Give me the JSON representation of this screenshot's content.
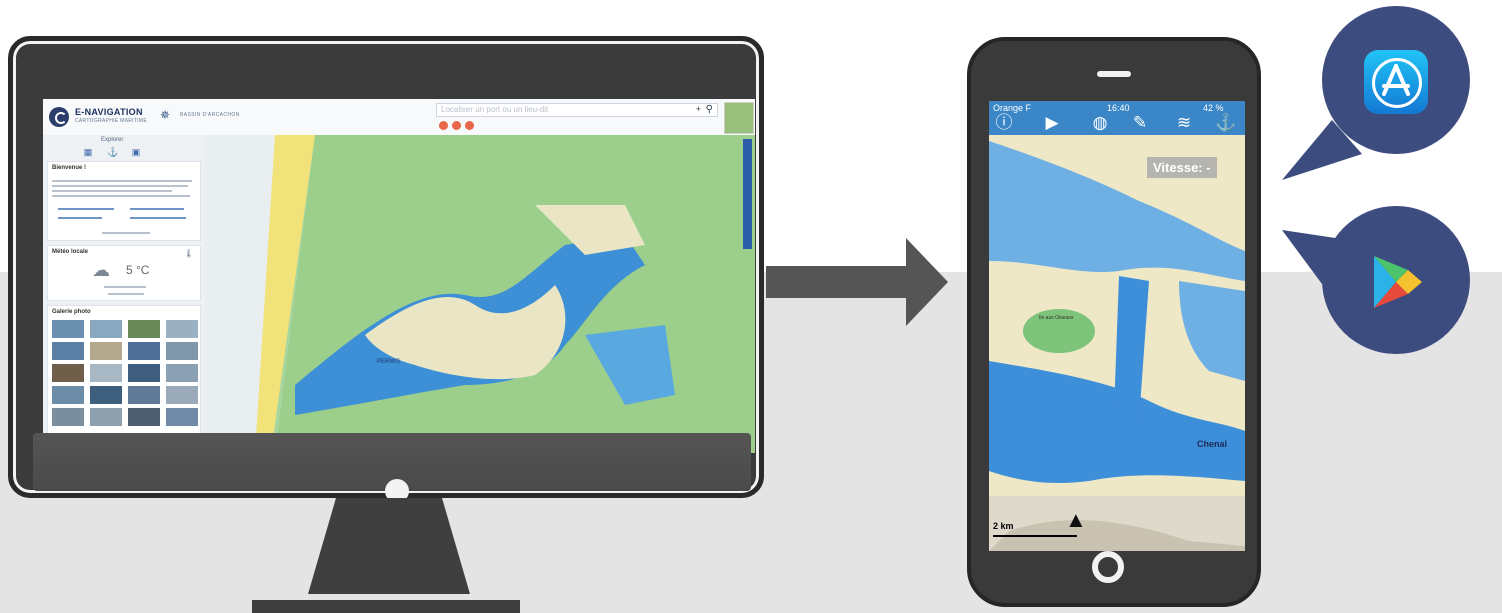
{
  "desktop_app": {
    "title": "E-NAVIGATION",
    "subtitle": "CARTOGRAPHIE MARITIME",
    "location": "BASSIN D'ARCACHON",
    "search_placeholder": "Localiser un port ou un lieu-dit",
    "tab_label": "Explorer",
    "welcome_title": "Bienvenue !",
    "weather_title": "Météo locale",
    "weather_temp": "5 °C",
    "gallery_title": "Galerie photo",
    "map_labels": [
      "PERMIS"
    ]
  },
  "phone_app": {
    "carrier": "Orange F",
    "time": "16:40",
    "battery": "42 %",
    "speed_label": "Vitesse: -",
    "scale": "2 km",
    "map_labels": [
      "Chenal",
      "Ile aux Oiseaux"
    ]
  },
  "colors": {
    "accent": "#2c5da8",
    "phone_toolbar": "#3b86c6",
    "bubble": "#3c4c7e",
    "arrow": "#555555"
  }
}
